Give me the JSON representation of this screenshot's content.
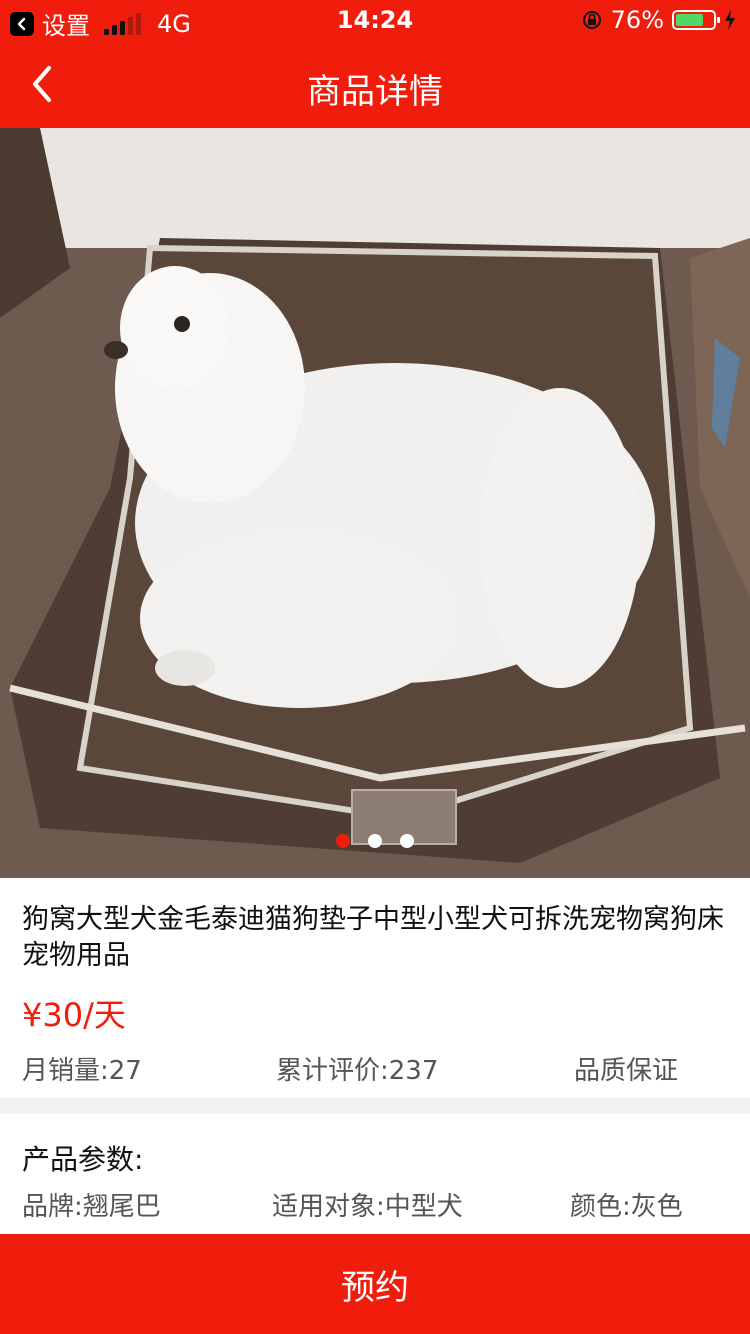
{
  "status_bar": {
    "back_app": "设置",
    "network": "4G",
    "time": "14:24",
    "battery_percent": "76%",
    "battery_level": 0.76
  },
  "navbar": {
    "title": "商品详情",
    "back_icon": "chevron-left-icon"
  },
  "carousel": {
    "image_count": 3,
    "active_index": 0
  },
  "product": {
    "title": "狗窝大型犬金毛泰迪猫狗垫子中型小型犬可拆洗宠物窝狗床宠物用品",
    "price": "¥30/天",
    "monthly_sales": "月销量:27",
    "total_reviews": "累计评价:237",
    "quality": "品质保证"
  },
  "params": {
    "heading": "产品参数:",
    "brand": "品牌:翘尾巴",
    "target": "适用对象:中型犬",
    "color": "颜色:灰色"
  },
  "footer": {
    "reserve_label": "预约"
  },
  "colors": {
    "brand_red": "#f01c0c",
    "active_dot": "#f01c0c"
  }
}
